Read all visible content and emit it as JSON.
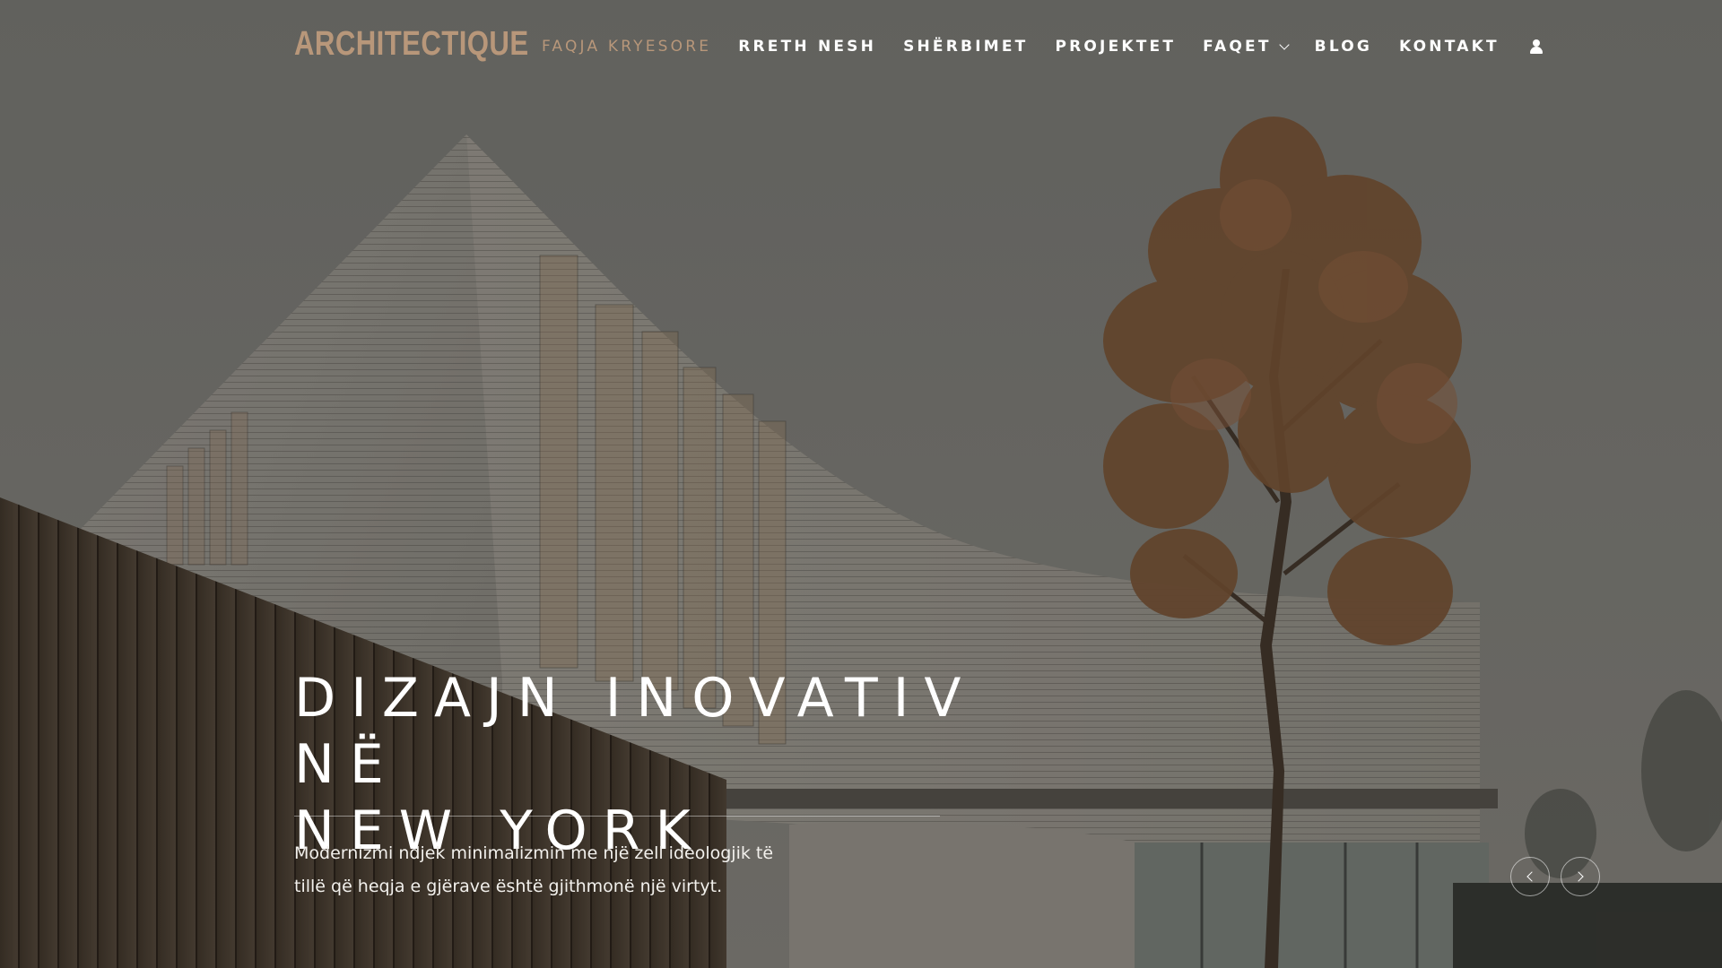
{
  "brand": {
    "logo_text": "ARCHITECTIQUE",
    "accent_color": "#b8977a"
  },
  "nav": {
    "items": [
      {
        "label": "FAQJA KRYESORE",
        "active": true
      },
      {
        "label": "RRETH NESH"
      },
      {
        "label": "SHËRBIMET"
      },
      {
        "label": "PROJEKTET"
      },
      {
        "label": "FAQET",
        "has_dropdown": true
      },
      {
        "label": "BLOG"
      },
      {
        "label": "KONTAKT"
      }
    ],
    "user_icon": "user-icon"
  },
  "hero": {
    "title_line1": "DIZAJN INOVATIV NË",
    "title_line2": "NEW YORK",
    "description": "Modernizmi ndjek minimalizmin me një zell ideologjik të tillë që heqja e gjërave është gjithmonë një virtyt.",
    "prev_icon": "chevron-left-icon",
    "next_icon": "chevron-right-icon"
  }
}
